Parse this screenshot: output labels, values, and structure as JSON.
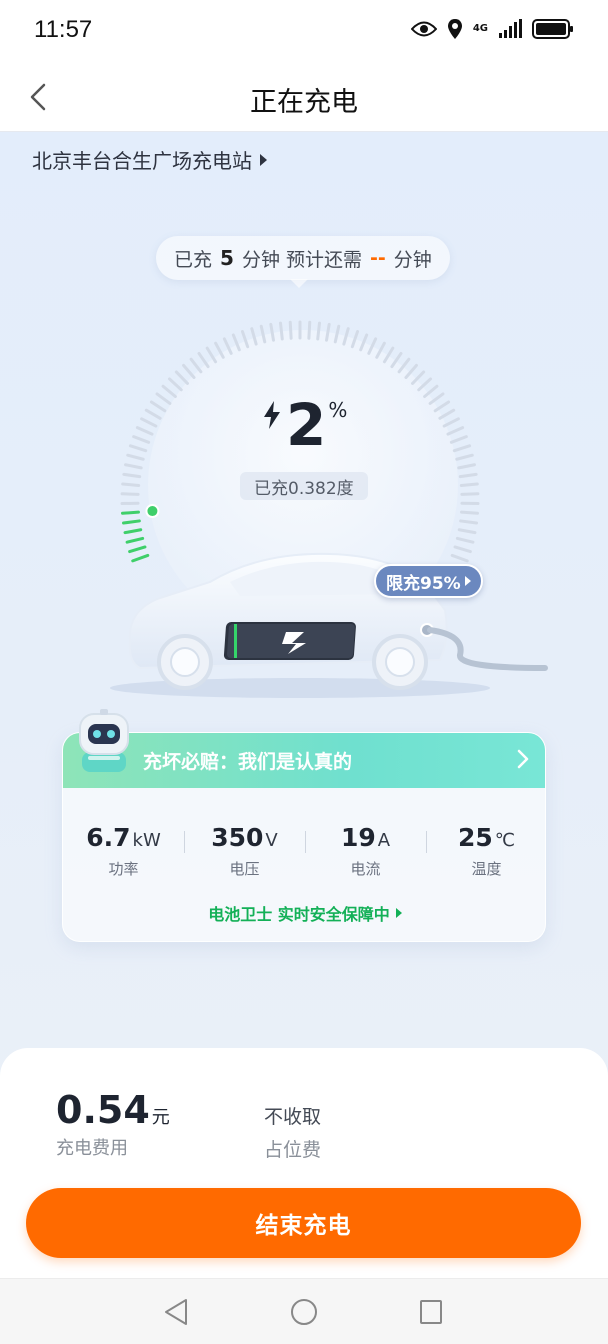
{
  "status_bar": {
    "time": "11:57",
    "network": "4G"
  },
  "header": {
    "title": "正在充电"
  },
  "station": {
    "name": "北京丰台合生广场充电站"
  },
  "charge_time": {
    "prefix": "已充",
    "minutes": "5",
    "mid": "分钟 预计还需",
    "remaining": "--",
    "suffix": "分钟"
  },
  "gauge": {
    "percent": "2",
    "percent_unit": "%",
    "energy": "已充0.382度",
    "progress": 0.02
  },
  "limit": {
    "label": "限充95%"
  },
  "guarantee": {
    "text": "充坏必赔：我们是认真的"
  },
  "stats": [
    {
      "value": "6.7",
      "unit": "kW",
      "label": "功率"
    },
    {
      "value": "350",
      "unit": "V",
      "label": "电压"
    },
    {
      "value": "19",
      "unit": "A",
      "label": "电流"
    },
    {
      "value": "25",
      "unit": "℃",
      "label": "温度"
    }
  ],
  "battery_guard": {
    "text": "电池卫士 实时安全保障中"
  },
  "fee": {
    "amount": "0.54",
    "unit": "元",
    "label": "充电费用"
  },
  "occupancy": {
    "line1": "不收取",
    "line2": "占位费"
  },
  "actions": {
    "end_label": "结束充电"
  },
  "colors": {
    "accent": "#ff6a00",
    "guard_green": "#13b057",
    "banner": "#79e6d6",
    "limit_badge": "#6b88bf"
  }
}
